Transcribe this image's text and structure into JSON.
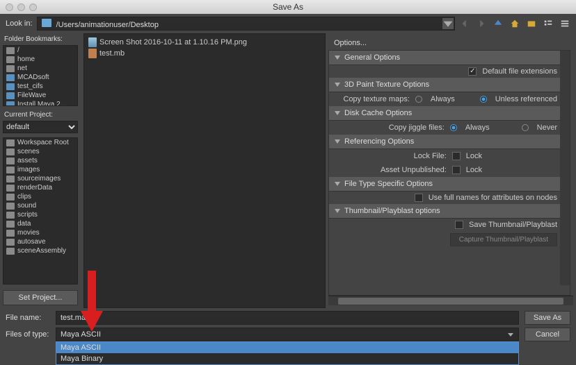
{
  "window": {
    "title": "Save As"
  },
  "path": {
    "label": "Look in:",
    "value": "/Users/animationuser/Desktop"
  },
  "toolbar_icons": [
    "back",
    "forward",
    "up",
    "home",
    "new-folder",
    "list-view",
    "detail-view"
  ],
  "bookmarks": {
    "label": "Folder Bookmarks:",
    "items": [
      "/",
      "home",
      "net",
      "MCADsoft",
      "test_cifs",
      "FileWave",
      "Install Maya 2..."
    ]
  },
  "current_project": {
    "label": "Current Project:",
    "value": "default"
  },
  "project_tree": [
    "Workspace Root",
    "scenes",
    "assets",
    "images",
    "sourceimages",
    "renderData",
    "clips",
    "sound",
    "scripts",
    "data",
    "movies",
    "autosave",
    "sceneAssembly"
  ],
  "set_project_btn": "Set Project...",
  "files": [
    {
      "name": "Screen Shot 2016-10-11 at 1.10.16 PM.png",
      "kind": "img"
    },
    {
      "name": "test.mb",
      "kind": "mb"
    }
  ],
  "options": {
    "label": "Options...",
    "general": {
      "title": "General Options",
      "default_ext_label": "Default file extensions",
      "default_ext_checked": true
    },
    "paint": {
      "title": "3D Paint Texture Options",
      "copy_maps_label": "Copy texture maps:",
      "opt_always": "Always",
      "opt_unless": "Unless referenced",
      "selected": "unless"
    },
    "disk": {
      "title": "Disk Cache Options",
      "copy_jiggle_label": "Copy jiggle files:",
      "opt_always": "Always",
      "opt_never": "Never",
      "selected": "always"
    },
    "ref": {
      "title": "Referencing Options",
      "lock_file_label": "Lock File:",
      "lock_file_value": "Lock",
      "asset_unpub_label": "Asset Unpublished:",
      "asset_unpub_value": "Lock"
    },
    "filetype": {
      "title": "File Type Specific Options",
      "full_names_label": "Use full names for attributes on nodes",
      "full_names_checked": false
    },
    "thumb": {
      "title": "Thumbnail/Playblast options",
      "save_thumb_label": "Save Thumbnail/Playblast",
      "save_thumb_checked": false,
      "capture_btn": "Capture Thumbnail/Playblast"
    }
  },
  "filename": {
    "label": "File name:",
    "value": "test.ma"
  },
  "filetype_row": {
    "label": "Files of type:",
    "selected": "Maya ASCII",
    "options": [
      "Maya ASCII",
      "Maya Binary"
    ]
  },
  "buttons": {
    "save": "Save As",
    "cancel": "Cancel"
  }
}
